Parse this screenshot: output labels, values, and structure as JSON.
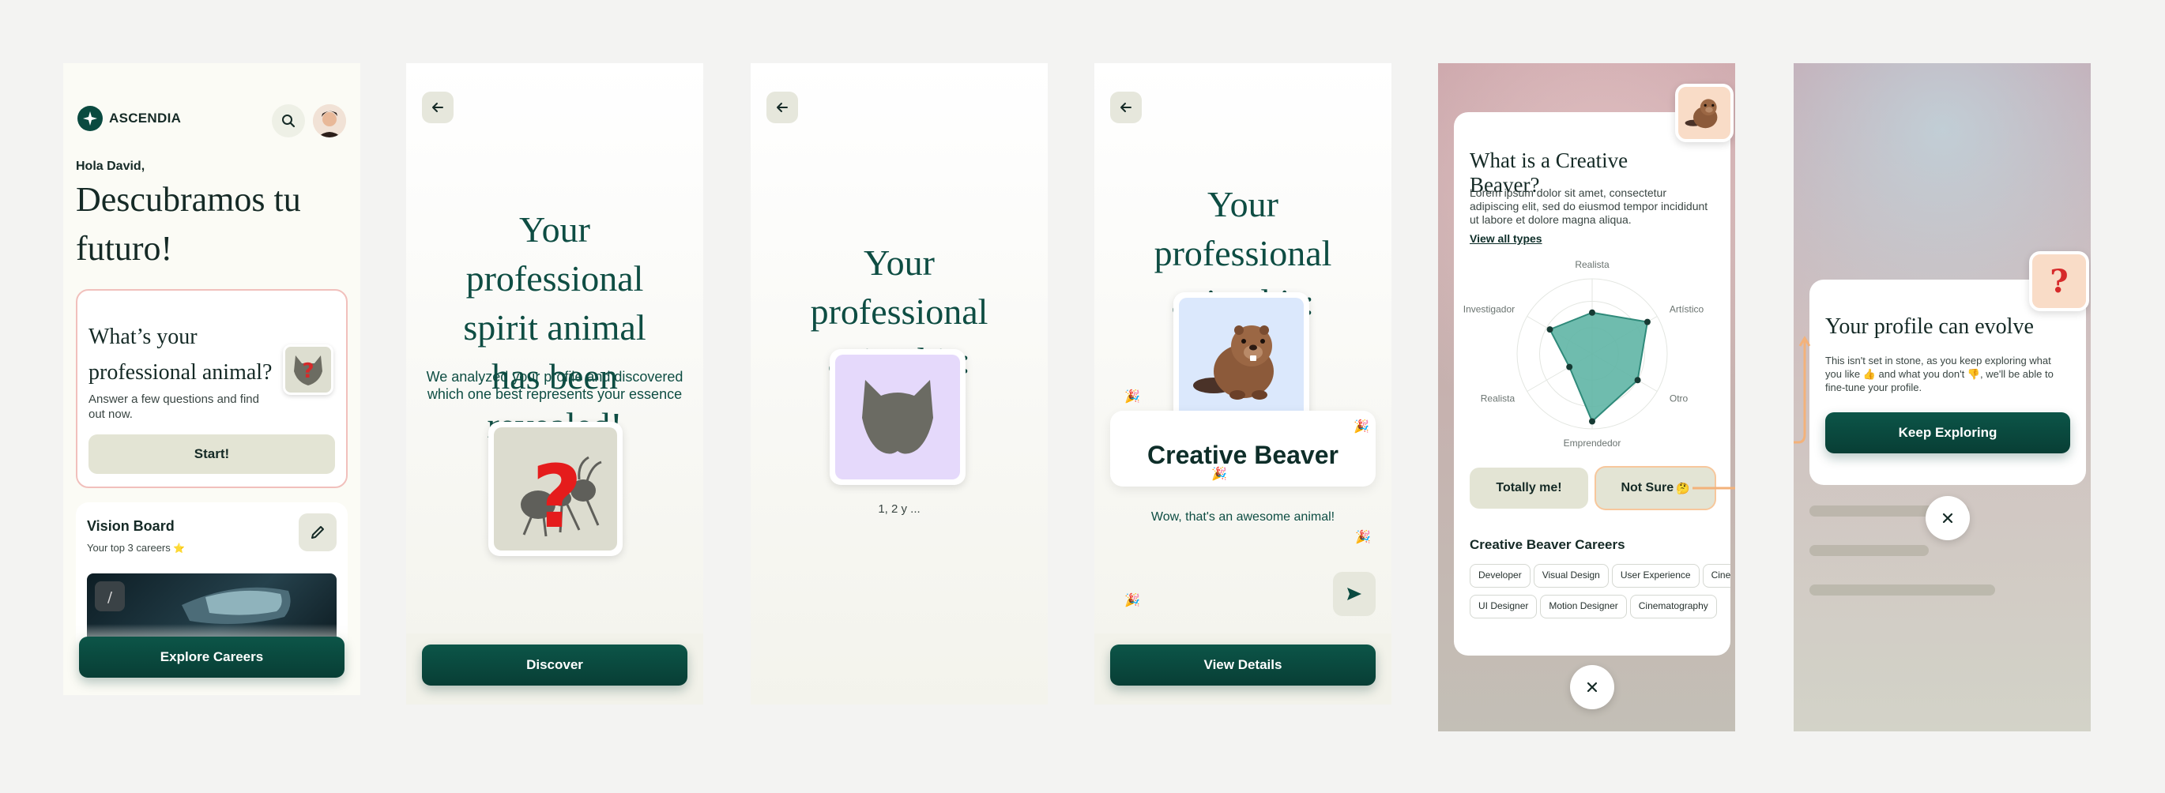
{
  "screen1": {
    "brand": "ASCENDIA",
    "greeting": "Hola David,",
    "headline": "Descubramos tu futuro!",
    "card_title": "What’s your professional animal?",
    "card_sub": "Answer a few questions and find out now.",
    "card_button": "Start!",
    "vision_title": "Vision Board",
    "vision_sub": "Your top 3 careers",
    "vision_star": "⭐",
    "cta": "Explore Careers"
  },
  "screen2": {
    "title": "Your professional spirit animal has been revealed!",
    "subtitle": "We analyzed your profile and discovered which one best represents your essence",
    "cta": "Discover"
  },
  "screen3": {
    "title": "Your professional animal is:",
    "counter": "1, 2 y ..."
  },
  "screen4": {
    "title": "Your professional animal is:",
    "animal": "Creative Beaver",
    "caption": "Wow, that's an awesome animal!",
    "cta": "View Details"
  },
  "screen5": {
    "title": "What is a Creative Beaver?",
    "description": "Lorem ipsum dolor sit amet, consectetur adipiscing elit, sed do eiusmod tempor incididunt ut labore et dolore magna aliqua.",
    "link": "View all types",
    "radar": {
      "axes": [
        "Realista",
        "Artístico",
        "Otro",
        "Emprendedor",
        "Realista",
        "Investigador"
      ],
      "values": [
        0.55,
        0.85,
        0.7,
        0.9,
        0.35,
        0.65
      ]
    },
    "btn_yes": "Totally me!",
    "btn_notsure": "Not Sure",
    "btn_notsure_emoji": "🤔",
    "careers_title": "Creative Beaver Careers",
    "chips_row1": [
      "Developer",
      "Visual Design",
      "User Experience",
      "Cine"
    ],
    "chips_row2": [
      "UI Designer",
      "Motion Designer",
      "Cinematography"
    ]
  },
  "screen6": {
    "title": "Your profile can evolve",
    "body": "This isn't set in stone, as you keep exploring what you like 👍 and what you don't 👎, we'll be able to fine-tune your profile.",
    "cta": "Keep Exploring"
  },
  "colors": {
    "primary": "#0a4a40",
    "accent_orange": "#f3b27a",
    "beige": "#e3e4d4"
  }
}
